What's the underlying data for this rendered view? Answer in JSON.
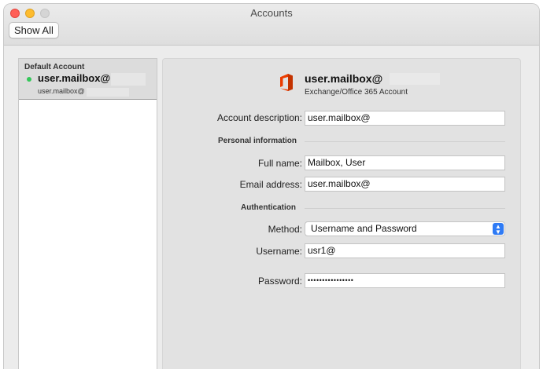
{
  "window": {
    "title": "Accounts"
  },
  "toolbar": {
    "show_all_label": "Show All"
  },
  "sidebar": {
    "section_header": "Default Account",
    "account": {
      "name": "user.mailbox@",
      "email": "user.mailbox@",
      "status": "online"
    }
  },
  "detail": {
    "header": {
      "account_name": "user.mailbox@",
      "account_type": "Exchange/Office 365 Account",
      "icon": "office-365-icon"
    },
    "account_description": {
      "label": "Account description:",
      "value": "user.mailbox@"
    },
    "personal_info_section": "Personal information",
    "full_name": {
      "label": "Full name:",
      "value": "Mailbox, User"
    },
    "email_address": {
      "label": "Email address:",
      "value": "user.mailbox@"
    },
    "authentication_section": "Authentication",
    "method": {
      "label": "Method:",
      "value": "Username and Password"
    },
    "username": {
      "label": "Username:",
      "value": "usr1@"
    },
    "password": {
      "label": "Password:",
      "value": "••••••••••••••••"
    }
  },
  "colors": {
    "accent": "#2f7bf5",
    "office_orange": "#eb3c00",
    "status_green": "#34c759"
  }
}
